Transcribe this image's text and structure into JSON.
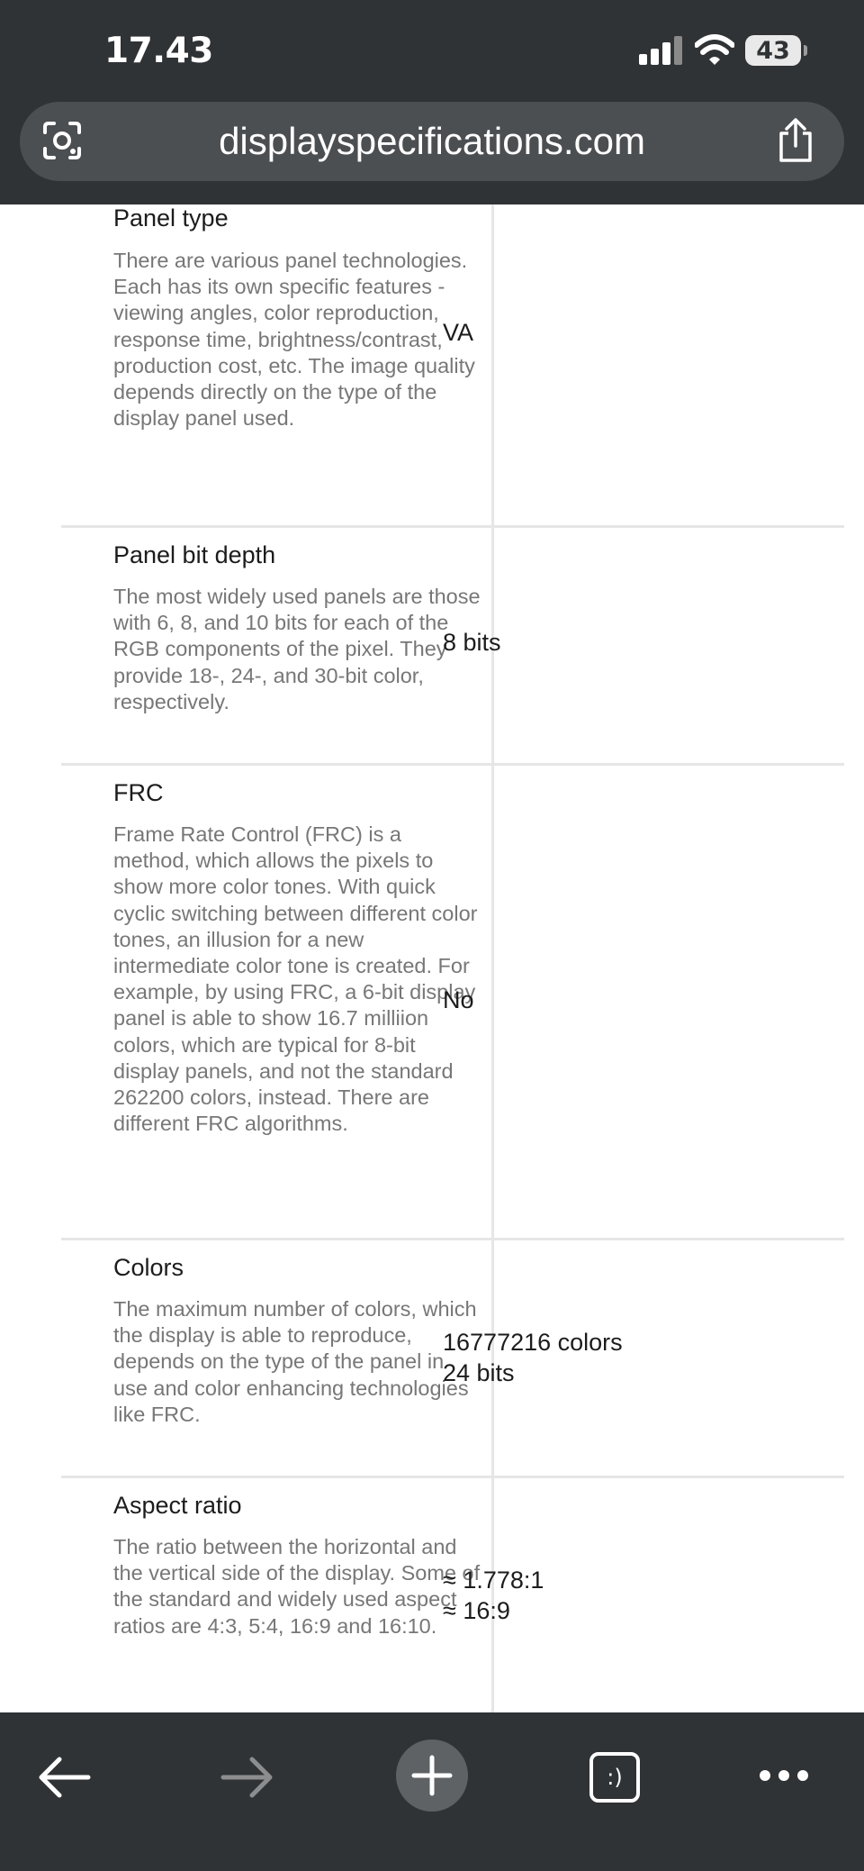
{
  "status_bar": {
    "time": "17.43",
    "battery": "43"
  },
  "browser": {
    "url": "displayspecifications.com"
  },
  "rows": [
    {
      "label": "Panel type",
      "description": "There are various panel technologies. Each has its own specific features - viewing angles, color reproduction, response time, brightness/contrast, production cost, etc. The image quality depends directly on the type of the display panel used.",
      "value": "VA"
    },
    {
      "label": "Panel bit depth",
      "description": "The most widely used panels are those with 6, 8, and 10 bits for each of the RGB components of the pixel. They provide 18-, 24-, and 30-bit color, respectively.",
      "value": "8 bits"
    },
    {
      "label": "FRC",
      "description": "Frame Rate Control (FRC) is a method, which allows the pixels to show more color tones. With quick cyclic switching between different color tones, an illusion for a new intermediate color tone is created. For example, by using FRC, a 6-bit display panel is able to show 16.7 milliion colors, which are typical for 8-bit display panels, and not the standard 262200 colors, instead. There are different FRC algorithms.",
      "value": "No"
    },
    {
      "label": "Colors",
      "description": "The maximum number of colors, which the display is able to reproduce, depends on the type of the panel in use and color enhancing technologies like FRC.",
      "value": "16777216 colors\n24 bits"
    },
    {
      "label": "Aspect ratio",
      "description": "The ratio between the horizontal and the vertical side of the display. Some of the standard and widely used aspect ratios are 4:3, 5:4, 16:9 and 16:10.",
      "value": "≈ 1.778:1\n≈ 16:9"
    }
  ],
  "toolbar": {
    "tabs_icon_glyph": ":)"
  },
  "colors": {
    "chrome_bg": "#303335",
    "url_bar_bg": "#4c4f52",
    "divider": "#e6e6e6",
    "description_text": "#777777"
  },
  "icons": [
    "lens-icon",
    "share-icon",
    "back-icon",
    "forward-icon",
    "plus-icon",
    "tabs-icon",
    "more-icon"
  ]
}
